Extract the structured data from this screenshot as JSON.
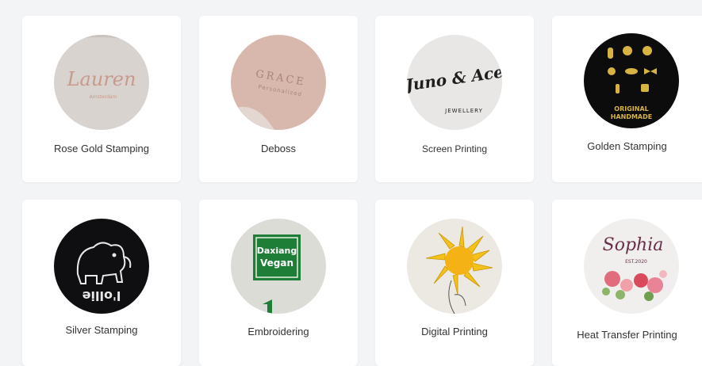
{
  "products": [
    {
      "label": "Rose Gold Stamping",
      "image_text": "Lauren",
      "image_subtext": "Amsterdam"
    },
    {
      "label": "Deboss",
      "image_text": "GRACE",
      "image_subtext": "Personalized"
    },
    {
      "label": "Screen Printing",
      "image_text": "Juno & Ace",
      "image_subtext": "JEWELLERY"
    },
    {
      "label": "Golden Stamping",
      "image_text": "ORIGINAL",
      "image_subtext": "HANDMADE"
    },
    {
      "label": "Silver Stamping",
      "image_text": "l'ollie"
    },
    {
      "label": "Embroidering",
      "image_text": "Daxiang",
      "image_subtext": "Vegan"
    },
    {
      "label": "Digital Printing"
    },
    {
      "label": "Heat Transfer Printing",
      "image_text": "Sophia",
      "image_subtext": "EST.2020"
    }
  ]
}
